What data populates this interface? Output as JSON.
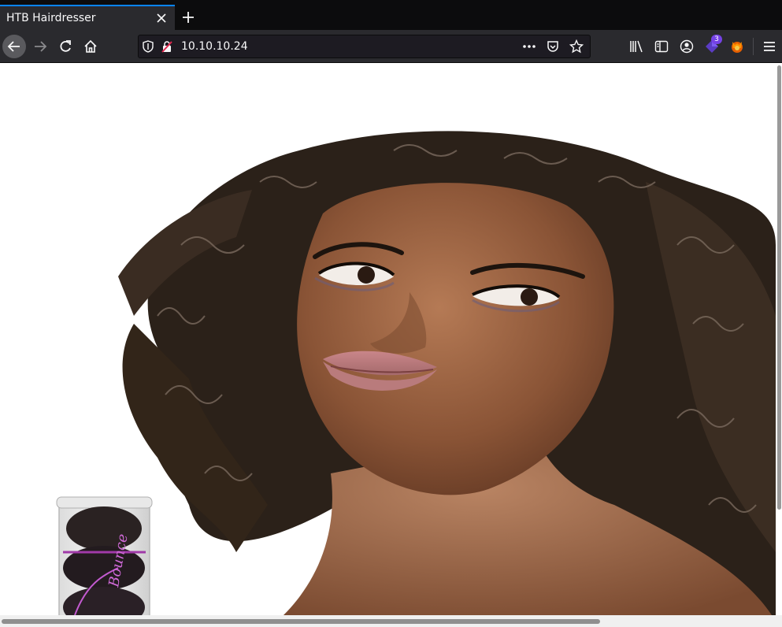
{
  "tab": {
    "title": "HTB Hairdresser"
  },
  "toolbar": {
    "url": "10.10.10.24",
    "extension_badge": "3"
  },
  "content": {
    "image_description": "Woman with curly hair next to a hair-product canister",
    "product_label": "Bounce"
  },
  "colors": {
    "tab_accent": "#0a84ff",
    "toolbar_bg": "#2a2a2e",
    "urlbar_bg": "#1d1b22"
  }
}
